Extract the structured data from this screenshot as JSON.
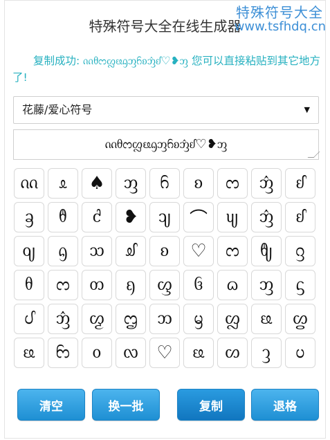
{
  "header": {
    "title": "特殊符号大全在线生成器",
    "watermark_line1": "特殊符号大全",
    "watermark_line2": "www.tsfhdq.cn"
  },
  "status_message": "复制成功: ᦶᦲᦂᦜᦕᦇᦀᦆᦈᦁᦊ♡❥ᦀ 您可以直接粘贴到其它地方了!",
  "category_select": {
    "selected": "花藤/爱心符号",
    "arrow": "▼"
  },
  "output_field": {
    "value": "ᦶᦲᦂᦜᦕᦇᦀᦆᦈᦁᦊ♡❥ᦀ"
  },
  "symbols": [
    "ᦶ",
    "ᦸ",
    "♠",
    "ᦀ",
    "ᦆ",
    "ᦈ",
    "ᦂ",
    "ᦁ",
    "ᦊ",
    "ᦃ",
    "ᦹ",
    "ᦺ",
    "❥",
    "ᦻ",
    "⌒",
    "ᦼ",
    "ᦁ",
    "ᦊ",
    "ᦽ",
    "ᦇ",
    "ᦉ",
    "ᦾ",
    "ᦈ",
    "♡",
    "ᦂ",
    "ᦿ",
    "ᦋ",
    "ᦲ",
    "ᦂ",
    "ᦎ",
    "ᦏ",
    "ᦐ",
    "ᦑ",
    "ᦒ",
    "ᦀ",
    "ᦓ",
    "ᦔ",
    "ᦁ",
    "ᦖ",
    "ᦗ",
    "ᦘ",
    "ᦙ",
    "ᦜ",
    "ᦕ",
    "ᦛ",
    "ᦕ",
    "ᦝ",
    "ᦞ",
    "ᦟ",
    "♡",
    "ᦕ",
    "ᦠ",
    "ᦡ",
    "ᦢ"
  ],
  "buttons": {
    "clear": "清空",
    "refresh": "换一批",
    "copy": "复制",
    "backspace": "退格"
  }
}
